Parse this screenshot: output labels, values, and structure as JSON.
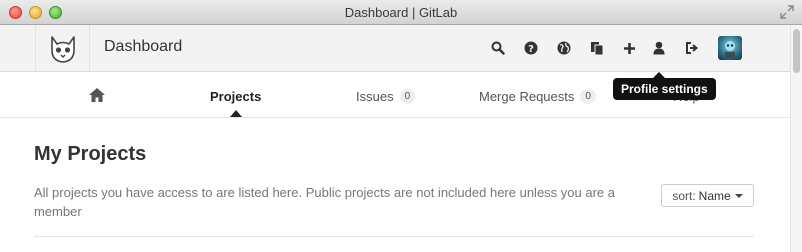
{
  "window": {
    "title": "Dashboard | GitLab"
  },
  "navbar": {
    "title": "Dashboard",
    "icons": [
      "search-icon",
      "help-icon",
      "globe-icon",
      "copy-icon",
      "plus-icon",
      "user-icon",
      "sign-out-icon"
    ]
  },
  "tooltip": {
    "text": "Profile settings"
  },
  "tabs": {
    "home_icon": "home-icon",
    "projects": "Projects",
    "issues": "Issues",
    "issues_count": "0",
    "merge_requests": "Merge Requests",
    "merge_requests_count": "0",
    "help_partial": "Help"
  },
  "content": {
    "heading": "My Projects",
    "description": "All projects you have access to are listed here. Public projects are not included here unless you are a member",
    "sort_label": "sort:",
    "sort_value": "Name"
  }
}
